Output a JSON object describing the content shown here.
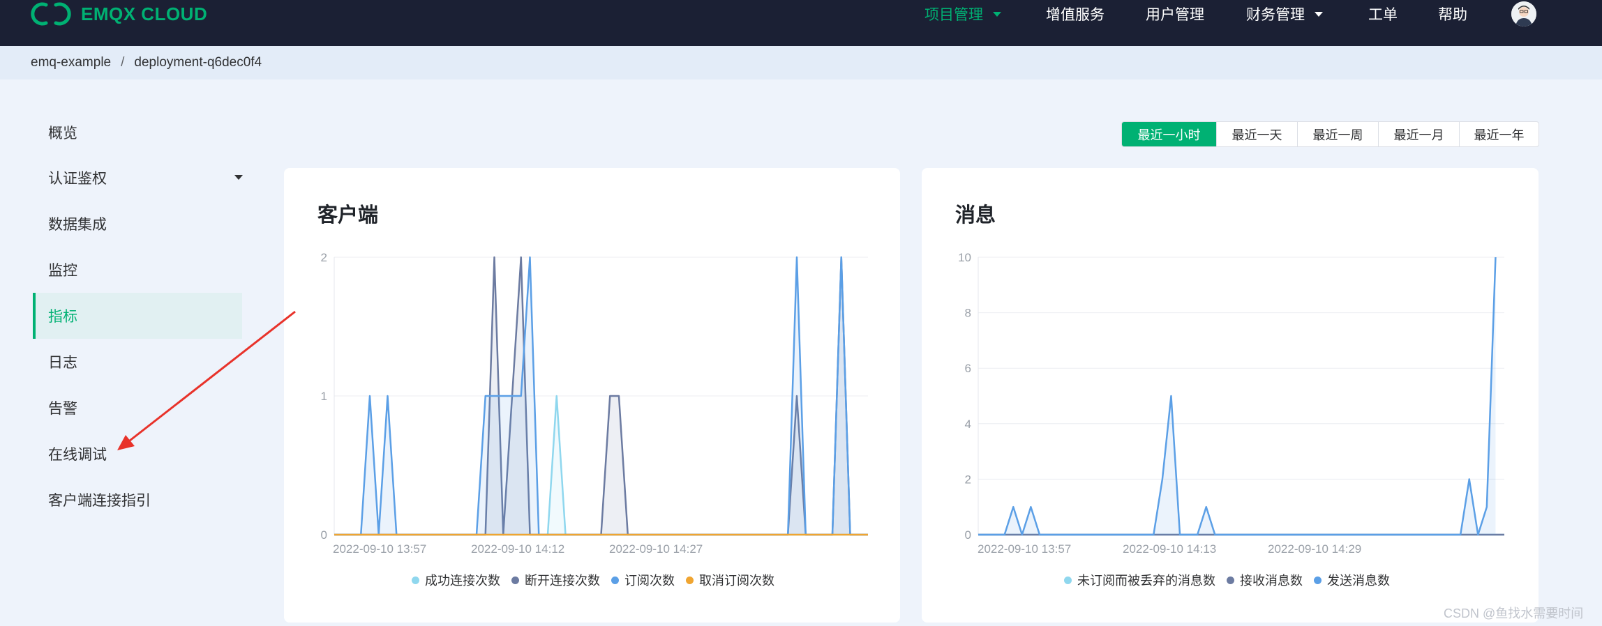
{
  "topbar": {
    "brand": "EMQX CLOUD",
    "nav": [
      {
        "label": "项目管理",
        "active": true,
        "dropdown": true
      },
      {
        "label": "增值服务",
        "active": false,
        "dropdown": false
      },
      {
        "label": "用户管理",
        "active": false,
        "dropdown": false
      },
      {
        "label": "财务管理",
        "active": false,
        "dropdown": true
      },
      {
        "label": "工单",
        "active": false,
        "dropdown": false
      },
      {
        "label": "帮助",
        "active": false,
        "dropdown": false
      }
    ]
  },
  "breadcrumb": {
    "project": "emq-example",
    "separator": "/",
    "deployment": "deployment-q6dec0f4"
  },
  "sidebar": {
    "items": [
      {
        "label": "概览",
        "active": false
      },
      {
        "label": "认证鉴权",
        "active": false,
        "dropdown": true
      },
      {
        "label": "数据集成",
        "active": false
      },
      {
        "label": "监控",
        "active": false
      },
      {
        "label": "指标",
        "active": true
      },
      {
        "label": "日志",
        "active": false
      },
      {
        "label": "告警",
        "active": false
      },
      {
        "label": "在线调试",
        "active": false
      },
      {
        "label": "客户端连接指引",
        "active": false
      }
    ]
  },
  "time_range": {
    "options": [
      "最近一小时",
      "最近一天",
      "最近一周",
      "最近一月",
      "最近一年"
    ],
    "selected": "最近一小时"
  },
  "cards": {
    "clients_title": "客户端",
    "messages_title": "消息"
  },
  "colors": {
    "accent": "#00b173",
    "topbar": "#1b2034",
    "annotation_arrow": "#e8322a"
  },
  "watermark": "CSDN @鱼找水需要时间",
  "chart_data": [
    {
      "type": "line",
      "title": "客户端",
      "ylim": [
        0,
        2
      ],
      "yticks": [
        "0",
        "1",
        "2"
      ],
      "xticks": [
        "2022-09-10 13:57",
        "2022-09-10 14:12",
        "2022-09-10 14:27"
      ],
      "legend_position": "bottom",
      "grid": true,
      "series": [
        {
          "name": "成功连接次数",
          "color": "#8fd7ee",
          "points": [
            [
              0,
              0
            ],
            [
              24,
              0
            ],
            [
              25,
              1
            ],
            [
              26,
              0
            ],
            [
              60,
              0
            ]
          ]
        },
        {
          "name": "断开连接次数",
          "color": "#6c7ba1",
          "points": [
            [
              0,
              0
            ],
            [
              17,
              0
            ],
            [
              18,
              2
            ],
            [
              19,
              0
            ],
            [
              21,
              2
            ],
            [
              22,
              0
            ],
            [
              30,
              0
            ],
            [
              31,
              1
            ],
            [
              32,
              1
            ],
            [
              33,
              0
            ],
            [
              51,
              0
            ],
            [
              52,
              1
            ],
            [
              53,
              0
            ],
            [
              56,
              0
            ],
            [
              57,
              2
            ],
            [
              58,
              0
            ],
            [
              60,
              0
            ]
          ]
        },
        {
          "name": "订阅次数",
          "color": "#5b9fe6",
          "points": [
            [
              0,
              0
            ],
            [
              3,
              0
            ],
            [
              4,
              1
            ],
            [
              5,
              0
            ],
            [
              6,
              1
            ],
            [
              7,
              0
            ],
            [
              16,
              0
            ],
            [
              17,
              1
            ],
            [
              21,
              1
            ],
            [
              22,
              2
            ],
            [
              23,
              0
            ],
            [
              51,
              0
            ],
            [
              52,
              2
            ],
            [
              53,
              0
            ],
            [
              56,
              0
            ],
            [
              57,
              2
            ],
            [
              58,
              0
            ],
            [
              60,
              0
            ]
          ]
        },
        {
          "name": "取消订阅次数",
          "color": "#f0a531",
          "points": [
            [
              0,
              0
            ],
            [
              60,
              0
            ]
          ]
        }
      ]
    },
    {
      "type": "line",
      "title": "消息",
      "ylim": [
        0,
        10
      ],
      "yticks": [
        "0",
        "2",
        "4",
        "6",
        "8",
        "10"
      ],
      "xticks": [
        "2022-09-10 13:57",
        "2022-09-10 14:13",
        "2022-09-10 14:29"
      ],
      "legend_position": "bottom",
      "grid": true,
      "series": [
        {
          "name": "未订阅而被丢弃的消息数",
          "color": "#8fd7ee",
          "points": [
            [
              0,
              0
            ],
            [
              60,
              0
            ]
          ]
        },
        {
          "name": "接收消息数",
          "color": "#6c7ba1",
          "points": [
            [
              0,
              0
            ],
            [
              60,
              0
            ]
          ]
        },
        {
          "name": "发送消息数",
          "color": "#5b9fe6",
          "points": [
            [
              0,
              0
            ],
            [
              3,
              0
            ],
            [
              4,
              1
            ],
            [
              5,
              0
            ],
            [
              6,
              1
            ],
            [
              7,
              0
            ],
            [
              20,
              0
            ],
            [
              21,
              2
            ],
            [
              22,
              5
            ],
            [
              23,
              0
            ],
            [
              25,
              0
            ],
            [
              26,
              1
            ],
            [
              27,
              0
            ],
            [
              55,
              0
            ],
            [
              56,
              2
            ],
            [
              57,
              0
            ],
            [
              58,
              1
            ],
            [
              59,
              10
            ]
          ]
        }
      ]
    }
  ]
}
